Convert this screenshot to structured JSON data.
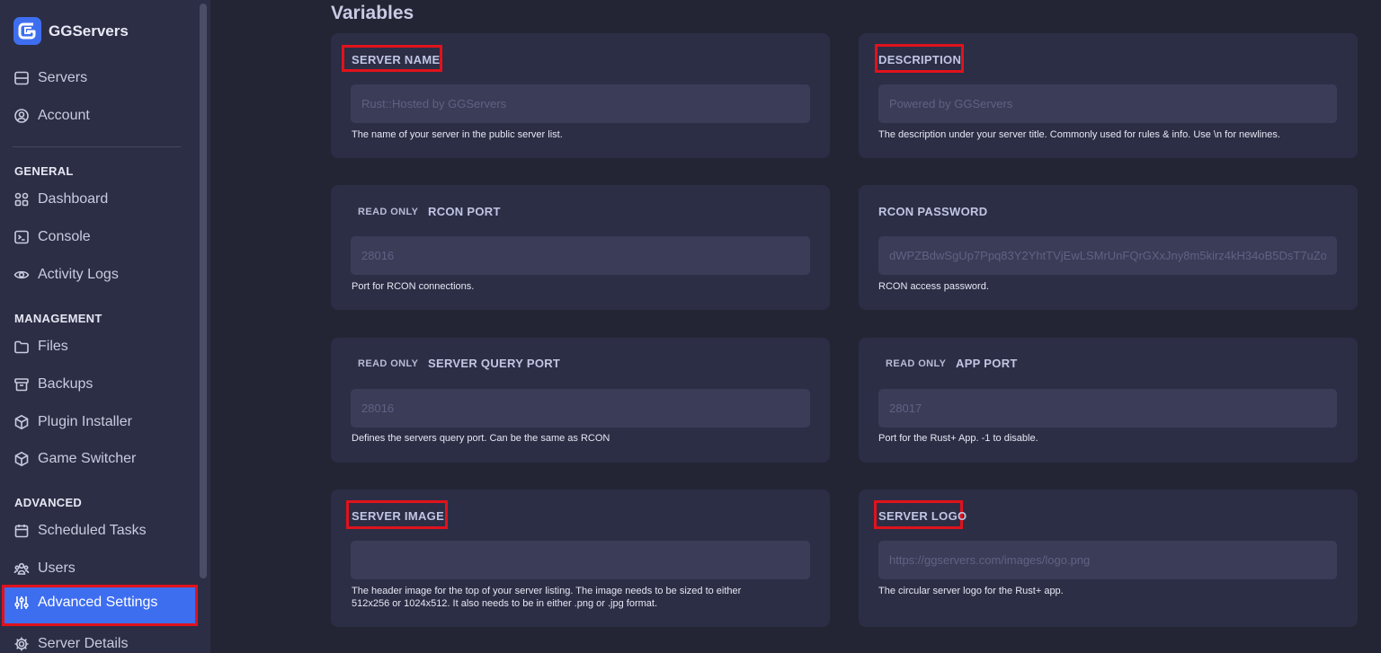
{
  "brand": {
    "name": "GGServers"
  },
  "sidebar": {
    "top_items": [
      {
        "label": "Servers",
        "icon": "server-icon"
      },
      {
        "label": "Account",
        "icon": "user-circle-icon"
      }
    ],
    "sections": [
      {
        "title": "GENERAL",
        "items": [
          {
            "label": "Dashboard",
            "icon": "grid-icon"
          },
          {
            "label": "Console",
            "icon": "terminal-icon"
          },
          {
            "label": "Activity Logs",
            "icon": "eye-icon"
          }
        ]
      },
      {
        "title": "MANAGEMENT",
        "items": [
          {
            "label": "Files",
            "icon": "folder-icon"
          },
          {
            "label": "Backups",
            "icon": "archive-icon"
          },
          {
            "label": "Plugin Installer",
            "icon": "cube-icon"
          },
          {
            "label": "Game Switcher",
            "icon": "cube-icon"
          }
        ]
      },
      {
        "title": "ADVANCED",
        "items": [
          {
            "label": "Scheduled Tasks",
            "icon": "calendar-icon"
          },
          {
            "label": "Users",
            "icon": "users-icon"
          },
          {
            "label": "Advanced Settings",
            "icon": "sliders-icon",
            "active": true
          },
          {
            "label": "Server Details",
            "icon": "gear-icon"
          }
        ]
      }
    ]
  },
  "main": {
    "title": "Variables",
    "read_only_label": "READ ONLY",
    "variables": [
      {
        "label": "SERVER NAME",
        "read_only": false,
        "highlighted": true,
        "value": "",
        "placeholder": "Rust::Hosted by GGServers",
        "help": "The name of your server in the public server list."
      },
      {
        "label": "DESCRIPTION",
        "read_only": false,
        "highlighted": true,
        "value": "",
        "placeholder": "Powered by GGServers",
        "help": "The description under your server title. Commonly used for rules & info. Use \\n for newlines."
      },
      {
        "label": "RCON PORT",
        "read_only": true,
        "highlighted": false,
        "value": "",
        "placeholder": "28016",
        "help": "Port for RCON connections."
      },
      {
        "label": "RCON PASSWORD",
        "read_only": false,
        "highlighted": false,
        "value": "",
        "placeholder": "dWPZBdwSgUp7Ppq83Y2YhtTVjEwLSMrUnFQrGXxJny8m5kirz4kH34oB5DsT7uZo",
        "help": "RCON access password."
      },
      {
        "label": "SERVER QUERY PORT",
        "read_only": true,
        "highlighted": false,
        "value": "",
        "placeholder": "28016",
        "help": "Defines the servers query port. Can be the same as RCON"
      },
      {
        "label": "APP PORT",
        "read_only": true,
        "highlighted": false,
        "value": "",
        "placeholder": "28017",
        "help": "Port for the Rust+ App. -1 to disable."
      },
      {
        "label": "SERVER IMAGE",
        "read_only": false,
        "highlighted": true,
        "value": "",
        "placeholder": "",
        "help_lines": [
          "The header image for the top of your server listing. The image needs to be sized to either",
          "512x256 or 1024x512. It also needs to be in either .png or .jpg format."
        ]
      },
      {
        "label": "SERVER LOGO",
        "read_only": false,
        "highlighted": true,
        "value": "",
        "placeholder": "https://ggservers.com/images/logo.png",
        "help": "The circular server logo for the Rust+ app."
      }
    ]
  },
  "colors": {
    "background": "#232535",
    "card": "#2c2e45",
    "input": "#3a3c58",
    "accent": "#3e6ef0",
    "highlight": "#e0121c"
  }
}
